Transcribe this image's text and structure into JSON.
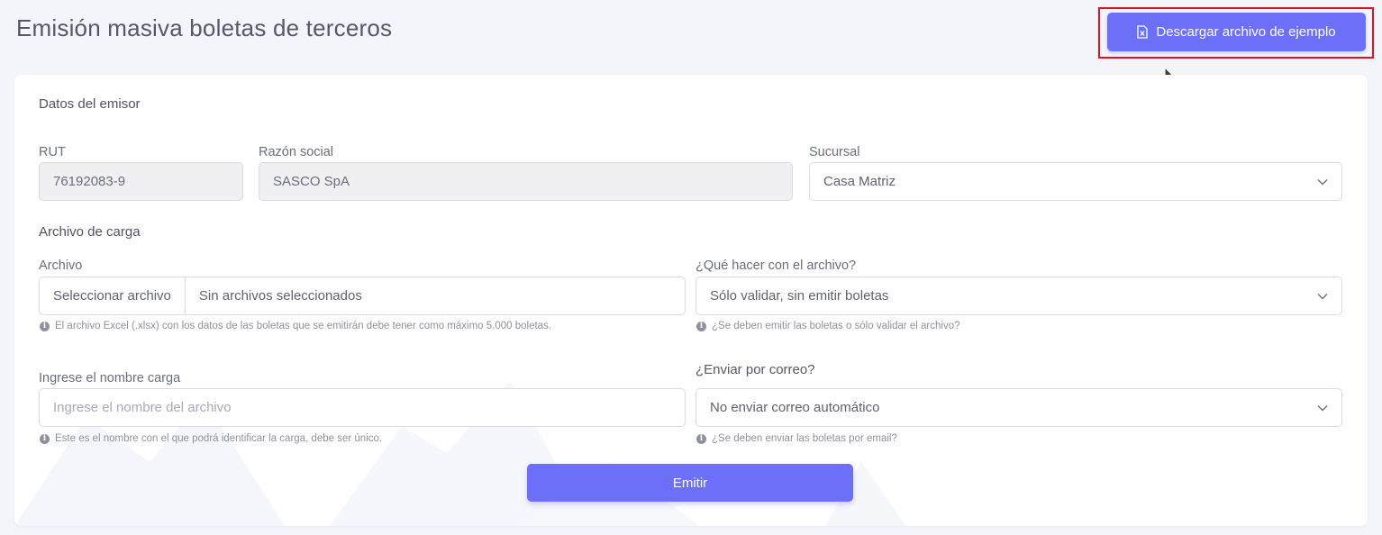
{
  "page": {
    "title": "Emisión masiva boletas de terceros",
    "download_button": "Descargar archivo de ejemplo"
  },
  "emisor": {
    "section_title": "Datos del emisor",
    "rut_label": "RUT",
    "rut_value": "76192083-9",
    "razon_label": "Razón social",
    "razon_value": "SASCO SpA",
    "sucursal_label": "Sucursal",
    "sucursal_value": "Casa Matriz"
  },
  "archivo": {
    "section_title": "Archivo de carga",
    "file_label": "Archivo",
    "file_button": "Seleccionar archivo",
    "file_status": "Sin archivos seleccionados",
    "file_help": "El archivo Excel (.xlsx) con los datos de las boletas que se emitirán debe tener como máximo 5.000 boletas.",
    "action_label": "¿Qué hacer con el archivo?",
    "action_value": "Sólo validar, sin emitir boletas",
    "action_help": "¿Se deben emitir las boletas o sólo validar el archivo?",
    "name_label": "Ingrese el nombre carga",
    "name_placeholder": "Ingrese el nombre del archivo",
    "name_value": "",
    "name_help": "Este es el nombre con el que podrá identificar la carga, debe ser único.",
    "email_label": "¿Enviar por correo?",
    "email_value": "No enviar correo automático",
    "email_help": "¿Se deben enviar las boletas por email?"
  },
  "actions": {
    "emit_button": "Emitir"
  },
  "colors": {
    "accent": "#6c6ff7",
    "highlight": "#e1101e",
    "background": "#f4f5fa"
  },
  "icons": {
    "download": "excel-file-icon",
    "select": "chevron-down-icon",
    "help": "info-icon"
  }
}
